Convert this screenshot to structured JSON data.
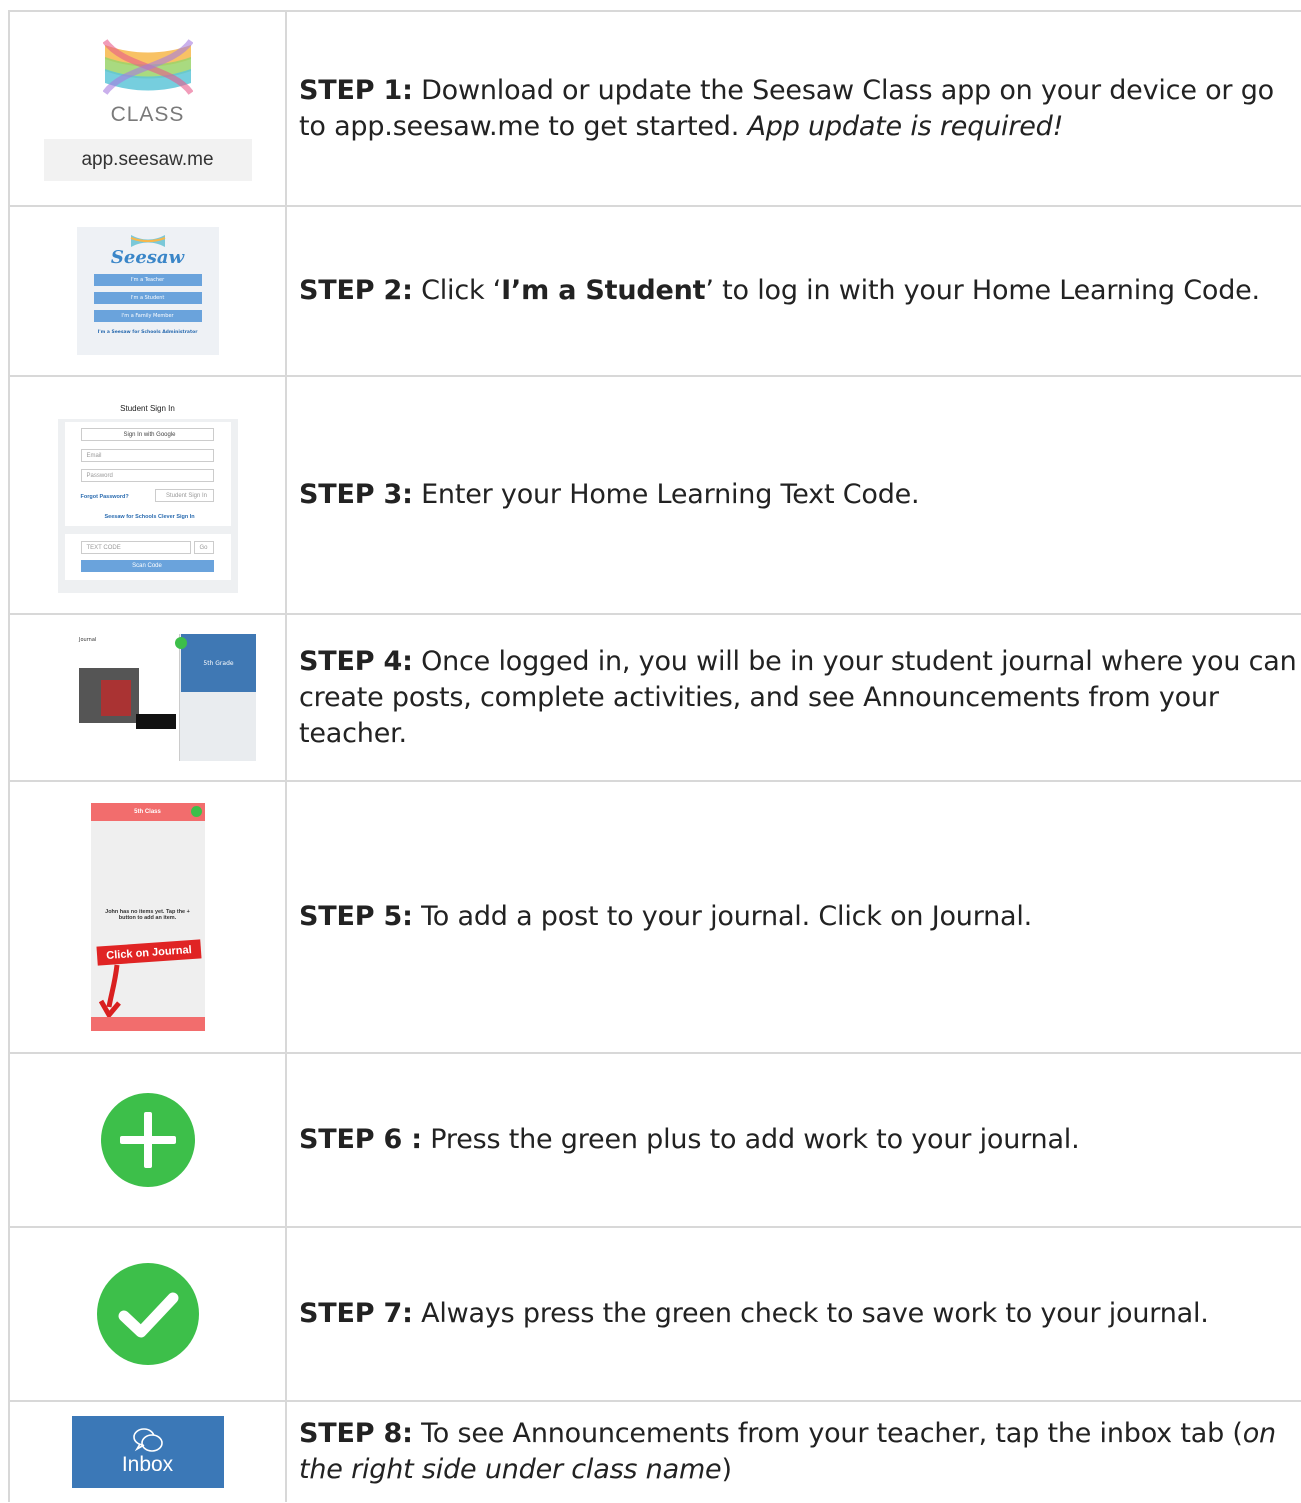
{
  "steps": [
    {
      "label": "STEP 1:",
      "text": " Download or update the Seesaw Class app on your device or go to app.seesaw.me to get started. ",
      "italic": "App update is required!",
      "image": {
        "class_text": "CLASS",
        "url_text": "app.seesaw.me"
      }
    },
    {
      "label": "STEP 2:",
      "text_before": " Click ‘",
      "bold": "I’m a Student",
      "text_after": "’ to log in with your Home Learning Code.",
      "image": {
        "brand": "Seesaw",
        "buttons": [
          "I'm a Teacher",
          "I'm a Student",
          "I'm a Family Member"
        ],
        "admin": "I'm a Seesaw for Schools Administrator"
      }
    },
    {
      "label": "STEP 3:",
      "text": " Enter your Home Learning Text Code.",
      "image": {
        "header": "Student Sign In",
        "google": "Sign In with Google",
        "email": "Email",
        "password": "Password",
        "forgot": "Forgot Password?",
        "sign_in": "Student Sign In",
        "clever": "Seesaw for Schools Clever Sign In",
        "text_code": "TEXT CODE",
        "go": "Go",
        "scan": "Scan Code"
      }
    },
    {
      "label": "STEP 4:",
      "text": " Once logged in, you will be in your student journal where you can create posts, complete activities, and see Announcements from your teacher.",
      "image": {
        "journal": "Journal",
        "class": "5th Grade"
      }
    },
    {
      "label": "STEP 5:",
      "text": " To add a post to your journal. Click on Journal.",
      "image": {
        "header": "5th Class",
        "message": "John has no items yet. Tap the + button to add an item.",
        "callout": "Click on Journal"
      }
    },
    {
      "label": "STEP 6 :",
      "text": " Press the green plus to add work to your journal."
    },
    {
      "label": "STEP 7:",
      "text": " Always press the green check to save work to your journal."
    },
    {
      "label": "STEP 8:",
      "text": " To see Announcements from your teacher, tap the inbox tab (",
      "italic": "on the right side under class name",
      "text_after": ")",
      "image": {
        "inbox": "Inbox"
      }
    }
  ],
  "colors": {
    "border": "#d8d8d8",
    "green": "#3dbf4a",
    "inbox_blue": "#3b78b7",
    "seesaw_blue": "#3a86c8"
  }
}
